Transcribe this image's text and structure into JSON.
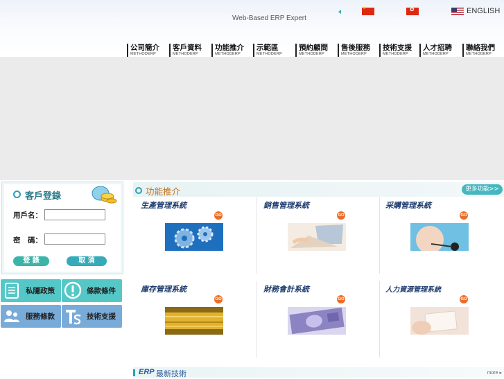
{
  "header": {
    "tagline": "Web-Based ERP Expert",
    "language_english": "ENGLISH",
    "flags": [
      "flag-cn-icon",
      "flag-hk-icon",
      "flag-us-icon"
    ]
  },
  "nav": [
    {
      "zh": "公司簡介",
      "en": "METHODERP"
    },
    {
      "zh": "客戶資料",
      "en": "METHODERP"
    },
    {
      "zh": "功能推介",
      "en": "METHODERP"
    },
    {
      "zh": "示範區",
      "en": "METHODERP"
    },
    {
      "zh": "預約顧問",
      "en": "METHODERP"
    },
    {
      "zh": "售後服務",
      "en": "METHODERP"
    },
    {
      "zh": "技術支援",
      "en": "METHODERP"
    },
    {
      "zh": "人才招聘",
      "en": "METHODERP"
    },
    {
      "zh": "聯絡我們",
      "en": "METHODERP"
    }
  ],
  "login": {
    "title": "客戶登錄",
    "username_label": "用戶名：",
    "password_label": "密　碼：",
    "username_value": "",
    "password_value": "",
    "login_button": "登 錄",
    "cancel_button": "取 消"
  },
  "quick_links": [
    {
      "label": "私隱政策",
      "icon": "notepad-icon"
    },
    {
      "label": "條款條件",
      "icon": "info-icon"
    },
    {
      "label": "服務條款",
      "icon": "users-icon"
    },
    {
      "label": "技術支援",
      "icon": "ts-icon"
    }
  ],
  "features": {
    "title": "功能推介",
    "more_label": "更多功能>>",
    "go_label": "GO",
    "items": [
      {
        "name": "生產管理系統",
        "image": "gears-image"
      },
      {
        "name": "銷售管理系統",
        "image": "laptop-image"
      },
      {
        "name": "采購管理系統",
        "image": "headset-image"
      },
      {
        "name": "庫存管理系統",
        "image": "warehouse-image"
      },
      {
        "name": "財務會計系統",
        "image": "banknote-image"
      },
      {
        "name": "人力資源管理系統",
        "image": "card-image"
      }
    ]
  },
  "news": {
    "erp": "ERP",
    "title_rest": "最新技術",
    "more": "more ▸"
  },
  "colors": {
    "accent_teal": "#2aa0b2",
    "title_orange": "#c5721a",
    "go_orange": "#f06a23",
    "quick_teal": "#56c7c7",
    "quick_blue": "#79abd9"
  }
}
